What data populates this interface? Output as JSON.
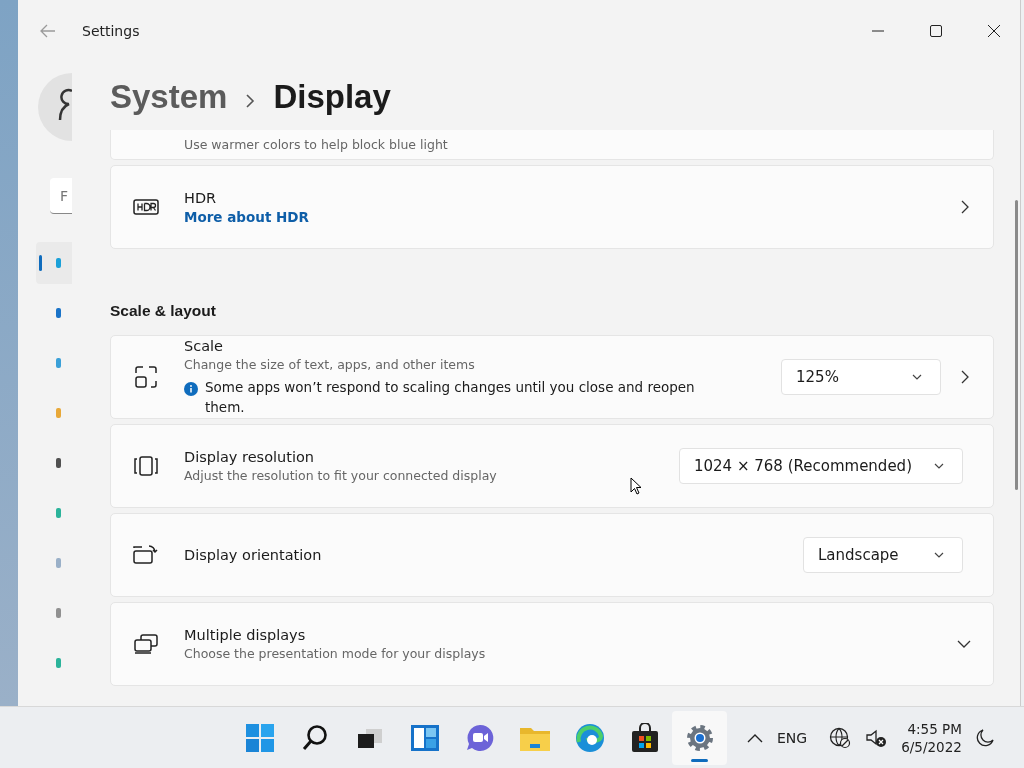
{
  "window": {
    "title": "Settings"
  },
  "sidebar": {
    "search": {
      "placeholder": "F"
    },
    "items": [
      {
        "selected": true,
        "color": "#1aa0d8"
      },
      {
        "selected": false,
        "color": "#1a73c8"
      },
      {
        "selected": false,
        "color": "#3aa0d8"
      },
      {
        "selected": false,
        "color": "#e8a838"
      },
      {
        "selected": false,
        "color": "#505050"
      },
      {
        "selected": false,
        "color": "#2bb39a"
      },
      {
        "selected": false,
        "color": "#9ab0c8"
      },
      {
        "selected": false,
        "color": "#909090"
      },
      {
        "selected": false,
        "color": "#2bb39a"
      }
    ]
  },
  "breadcrumb": [
    "System",
    "Display"
  ],
  "settings": [
    {
      "kind": "partial",
      "description": "Use warmer colors to help block blue light"
    },
    {
      "kind": "link",
      "title": "HDR",
      "link": "More about HDR"
    },
    {
      "kind": "heading",
      "title": "Scale & layout"
    },
    {
      "kind": "dropdown",
      "title": "Scale",
      "description": "Change the size of text, apps, and other items",
      "note": "Some apps won’t respond to scaling changes until you close and reopen them.",
      "value": "125%",
      "chevron": true
    },
    {
      "kind": "dropdown",
      "title": "Display resolution",
      "description": "Adjust the resolution to fit your connected display",
      "value": "1024 × 768 (Recommended)",
      "chevron": false
    },
    {
      "kind": "dropdown",
      "title": "Display orientation",
      "value": "Landscape",
      "chevron": false
    },
    {
      "kind": "expander",
      "title": "Multiple displays",
      "description": "Choose the presentation mode for your displays"
    }
  ],
  "taskbar": {
    "apps": [
      {
        "kind": "start",
        "selected": false
      },
      {
        "kind": "search",
        "selected": false
      },
      {
        "kind": "taskview",
        "selected": false
      },
      {
        "kind": "widgets",
        "selected": false
      },
      {
        "kind": "chat",
        "selected": false
      },
      {
        "kind": "explorer",
        "selected": false
      },
      {
        "kind": "edge",
        "selected": false
      },
      {
        "kind": "store",
        "selected": false
      },
      {
        "kind": "settings",
        "selected": true
      }
    ],
    "language": "ENG",
    "time": "4:55 PM",
    "date": "6/5/2022"
  }
}
